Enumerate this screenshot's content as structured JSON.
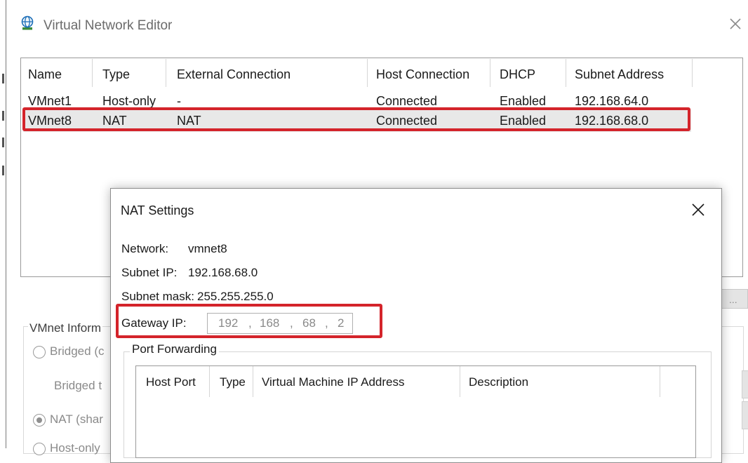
{
  "window": {
    "title": "Virtual Network Editor",
    "icon": "globe-network-icon"
  },
  "network_table": {
    "columns": [
      "Name",
      "Type",
      "External Connection",
      "Host Connection",
      "DHCP",
      "Subnet Address"
    ],
    "rows": [
      {
        "name": "VMnet1",
        "type": "Host-only",
        "external": "-",
        "host": "Connected",
        "dhcp": "Enabled",
        "subnet": "192.168.64.0"
      },
      {
        "name": "VMnet8",
        "type": "NAT",
        "external": "NAT",
        "host": "Connected",
        "dhcp": "Enabled",
        "subnet": "192.168.68.0"
      }
    ]
  },
  "vmnet_info": {
    "title": "VMnet Inform",
    "bridged_label": "Bridged (c",
    "bridged_to_label": "Bridged t",
    "nat_label": "NAT (shar",
    "host_only_label": "Host-only",
    "right_button_label": "..."
  },
  "nat_settings": {
    "title": "NAT Settings",
    "network_label": "Network:",
    "network_value": "vmnet8",
    "subnet_ip_label": "Subnet IP:",
    "subnet_ip_value": "192.168.68.0",
    "subnet_mask_label": "Subnet mask:",
    "subnet_mask_value": "255.255.255.0",
    "gateway_label": "Gateway IP:",
    "gateway_octets": [
      "192",
      "168",
      "68",
      "2"
    ],
    "port_forwarding": {
      "title": "Port Forwarding",
      "columns": [
        "Host Port",
        "Type",
        "Virtual Machine IP Address",
        "Description"
      ]
    }
  },
  "colors": {
    "highlight_red": "#d4242b",
    "selection_bg": "#e8e8e8"
  }
}
